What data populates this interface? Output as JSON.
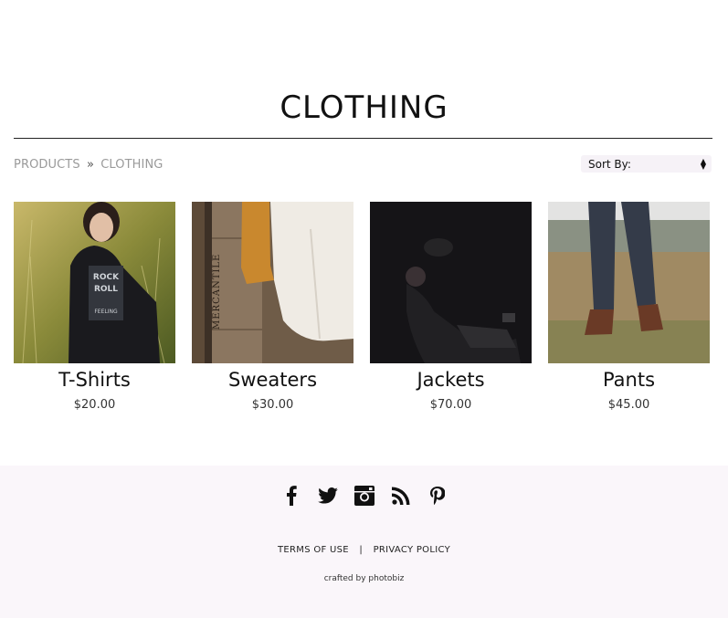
{
  "page": {
    "title": "CLOTHING"
  },
  "breadcrumb": {
    "root": "PRODUCTS",
    "separator": "»",
    "current": "CLOTHING"
  },
  "sort": {
    "label": "Sort By:"
  },
  "products": [
    {
      "name": "T-Shirts",
      "price": "$20.00"
    },
    {
      "name": "Sweaters",
      "price": "$30.00"
    },
    {
      "name": "Jackets",
      "price": "$70.00"
    },
    {
      "name": "Pants",
      "price": "$45.00"
    }
  ],
  "footer": {
    "social_icons": [
      "facebook-icon",
      "twitter-icon",
      "instagram-icon",
      "rss-icon",
      "pinterest-icon"
    ],
    "terms_label": "TERMS OF USE",
    "divider": "|",
    "privacy_label": "PRIVACY POLICY",
    "credit": "crafted by photobiz"
  },
  "colors": {
    "footer_bg": "#faf6fa",
    "breadcrumb": "#9a9a9a",
    "sort_bg": "#f6f2f7"
  }
}
